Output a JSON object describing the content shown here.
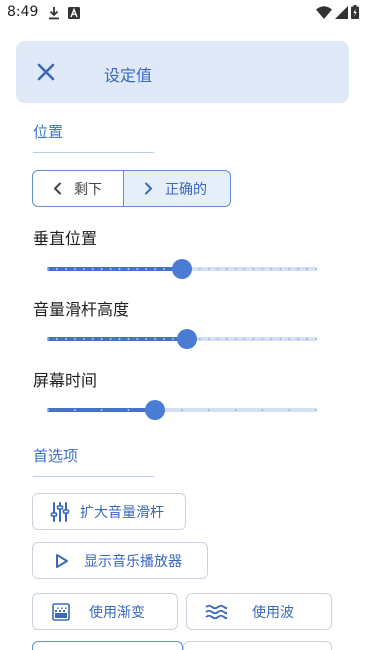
{
  "status_bar": {
    "time": "8:49"
  },
  "header": {
    "title": "设定值"
  },
  "position_section": {
    "title": "位置",
    "segment_left_label": "剩下",
    "segment_right_label": "正确的",
    "selected": "正确的"
  },
  "sliders": [
    {
      "label": "垂直位置",
      "value": 0.5
    },
    {
      "label": "音量滑杆高度",
      "value": 0.52
    },
    {
      "label": "屏幕时间",
      "value": 0.4
    }
  ],
  "preferences_section": {
    "title": "首选项",
    "expand_volume_slider": "扩大音量滑杆",
    "show_music_player": "显示音乐播放器",
    "use_gradient": "使用渐变",
    "use_wave": "使用波"
  },
  "colors": {
    "accent": "#3a68bd",
    "header_bg": "#dfe9f7",
    "slider_fill": "#4474c8",
    "slider_track": "#d4e1f4"
  }
}
